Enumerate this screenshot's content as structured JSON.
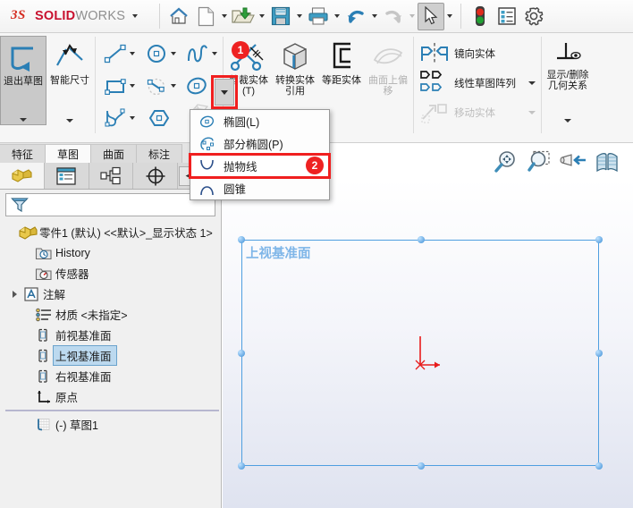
{
  "app": {
    "brand_3ds": "3DS",
    "brand_bold": "SOLID",
    "brand_light": "WORKS",
    "accent_red": "#c8102e",
    "highlight_red": "#f01f1f",
    "selection_blue": "#bcd9ef",
    "plane_blue": "#4f9fe0"
  },
  "quick_access": {
    "items": [
      {
        "name": "home",
        "icon": "home-icon",
        "has_caret": false,
        "enabled": true,
        "selected": false
      },
      {
        "name": "new",
        "icon": "new-document-icon",
        "has_caret": true,
        "enabled": true,
        "selected": false
      },
      {
        "name": "open",
        "icon": "open-folder-icon",
        "has_caret": true,
        "enabled": true,
        "selected": false
      },
      {
        "name": "save",
        "icon": "save-floppy-icon",
        "has_caret": true,
        "enabled": true,
        "selected": false
      },
      {
        "name": "print",
        "icon": "printer-icon",
        "has_caret": true,
        "enabled": true,
        "selected": false
      },
      {
        "name": "undo",
        "icon": "undo-arrow-icon",
        "has_caret": true,
        "enabled": true,
        "selected": false
      },
      {
        "name": "redo",
        "icon": "redo-arrow-icon",
        "has_caret": true,
        "enabled": false,
        "selected": false
      },
      {
        "name": "select",
        "icon": "cursor-arrow-icon",
        "has_caret": true,
        "enabled": true,
        "selected": true
      }
    ],
    "right_icons": [
      {
        "name": "rebuild-status",
        "icon": "traffic-light-icon"
      },
      {
        "name": "options-list",
        "icon": "list-options-icon"
      },
      {
        "name": "settings",
        "icon": "gear-icon"
      }
    ]
  },
  "ribbon": {
    "exit_sketch": {
      "label": "退出草图",
      "icon": "exit-sketch-icon",
      "active": true,
      "has_dropdown": true
    },
    "smart_dimension": {
      "label": "智能尺寸",
      "icon": "smart-dimension-icon",
      "has_dropdown": true
    },
    "sketch_tools": [
      {
        "name": "line",
        "icon": "line-icon",
        "has_caret": true
      },
      {
        "name": "circle",
        "icon": "circle-icon",
        "has_caret": true
      },
      {
        "name": "spline",
        "icon": "spline-icon",
        "has_caret": true
      },
      {
        "name": "rectangle",
        "icon": "rectangle-icon",
        "has_caret": true
      },
      {
        "name": "arc",
        "icon": "arc-icon",
        "has_caret": true
      },
      {
        "name": "ellipse",
        "icon": "ellipse-icon",
        "has_caret": false
      },
      {
        "name": "sketch-fillet",
        "icon": "sketch-fillet-icon",
        "has_caret": true
      },
      {
        "name": "polygon",
        "icon": "polygon-icon",
        "has_caret": false
      },
      {
        "name": "text",
        "icon": "text-a-icon",
        "has_caret": false
      }
    ],
    "trim": {
      "label": "剪裁实体(T)",
      "icon": "trim-scissors-icon"
    },
    "convert": {
      "label": "转换实体引用",
      "icon": "convert-entities-icon"
    },
    "offset": {
      "label": "等距实体",
      "icon": "offset-entities-icon"
    },
    "surface_offset": {
      "label": "曲面上偏移",
      "icon": "offset-on-surface-icon",
      "enabled": false
    },
    "mirror": {
      "label": "镜向实体",
      "icon": "mirror-entities-icon",
      "has_caret": false
    },
    "linear_pattern": {
      "label": "线性草图阵列",
      "icon": "linear-pattern-icon",
      "has_caret": true
    },
    "move_entities": {
      "label": "移动实体",
      "icon": "move-entities-icon",
      "has_caret": true,
      "enabled": false
    },
    "display_delete_relations": {
      "label": "显示/删除几何关系",
      "icon": "display-relations-icon",
      "has_dropdown": true
    }
  },
  "tabs": [
    {
      "label": "特征",
      "active": false
    },
    {
      "label": "草图",
      "active": true
    },
    {
      "label": "曲面",
      "active": false
    },
    {
      "label": "标注",
      "active": false
    }
  ],
  "view_toolbar": [
    {
      "name": "zoom-to-fit",
      "icon": "zoom-fit-icon"
    },
    {
      "name": "zoom-to-area",
      "icon": "zoom-area-icon"
    },
    {
      "name": "view-orientation",
      "icon": "view-orientation-icon"
    },
    {
      "name": "section-view",
      "icon": "section-view-icon"
    }
  ],
  "panel_tabs": [
    {
      "name": "feature-manager",
      "icon": "feature-manager-icon",
      "active": true
    },
    {
      "name": "property-manager",
      "icon": "property-manager-icon",
      "active": false
    },
    {
      "name": "configuration-manager",
      "icon": "configuration-manager-icon",
      "active": false
    },
    {
      "name": "dimxpert-manager",
      "icon": "dimxpert-icon",
      "active": false
    }
  ],
  "panel_nav": {
    "prev": "◀",
    "next": "▶"
  },
  "filter": {
    "icon": "filter-funnel-icon",
    "value": "",
    "placeholder": ""
  },
  "tree": {
    "root": {
      "label": "零件1 (默认) <<默认>_显示状态 1>",
      "icon": "part-icon"
    },
    "items": [
      {
        "label": "History",
        "icon": "history-folder-icon",
        "expandable": false,
        "selected": false
      },
      {
        "label": "传感器",
        "icon": "sensors-folder-icon",
        "expandable": false,
        "selected": false
      },
      {
        "label": "注解",
        "icon": "annotations-icon",
        "expandable": true,
        "selected": false
      },
      {
        "label": "材质 <未指定>",
        "icon": "material-icon",
        "expandable": false,
        "selected": false
      },
      {
        "label": "前视基准面",
        "icon": "plane-icon",
        "expandable": false,
        "selected": false
      },
      {
        "label": "上视基准面",
        "icon": "plane-icon",
        "expandable": false,
        "selected": true
      },
      {
        "label": "右视基准面",
        "icon": "plane-icon",
        "expandable": false,
        "selected": false
      },
      {
        "label": "原点",
        "icon": "origin-icon",
        "expandable": false,
        "selected": false
      }
    ],
    "after_divider": [
      {
        "label": "(-) 草图1",
        "icon": "sketch-icon",
        "expandable": false,
        "selected": false
      }
    ]
  },
  "graphics": {
    "plane_label": "上视基准面",
    "origin_name": "origin-marker"
  },
  "dropdown_menu": {
    "items": [
      {
        "label": "椭圆(L)",
        "icon": "ellipse-icon",
        "highlighted": false
      },
      {
        "label": "部分椭圆(P)",
        "icon": "partial-ellipse-icon",
        "highlighted": false
      },
      {
        "label": "抛物线",
        "icon": "parabola-icon",
        "highlighted": true
      },
      {
        "label": "圆锥",
        "icon": "conic-icon",
        "highlighted": false
      }
    ]
  },
  "annotations": {
    "badge_1": "1",
    "badge_2": "2"
  }
}
